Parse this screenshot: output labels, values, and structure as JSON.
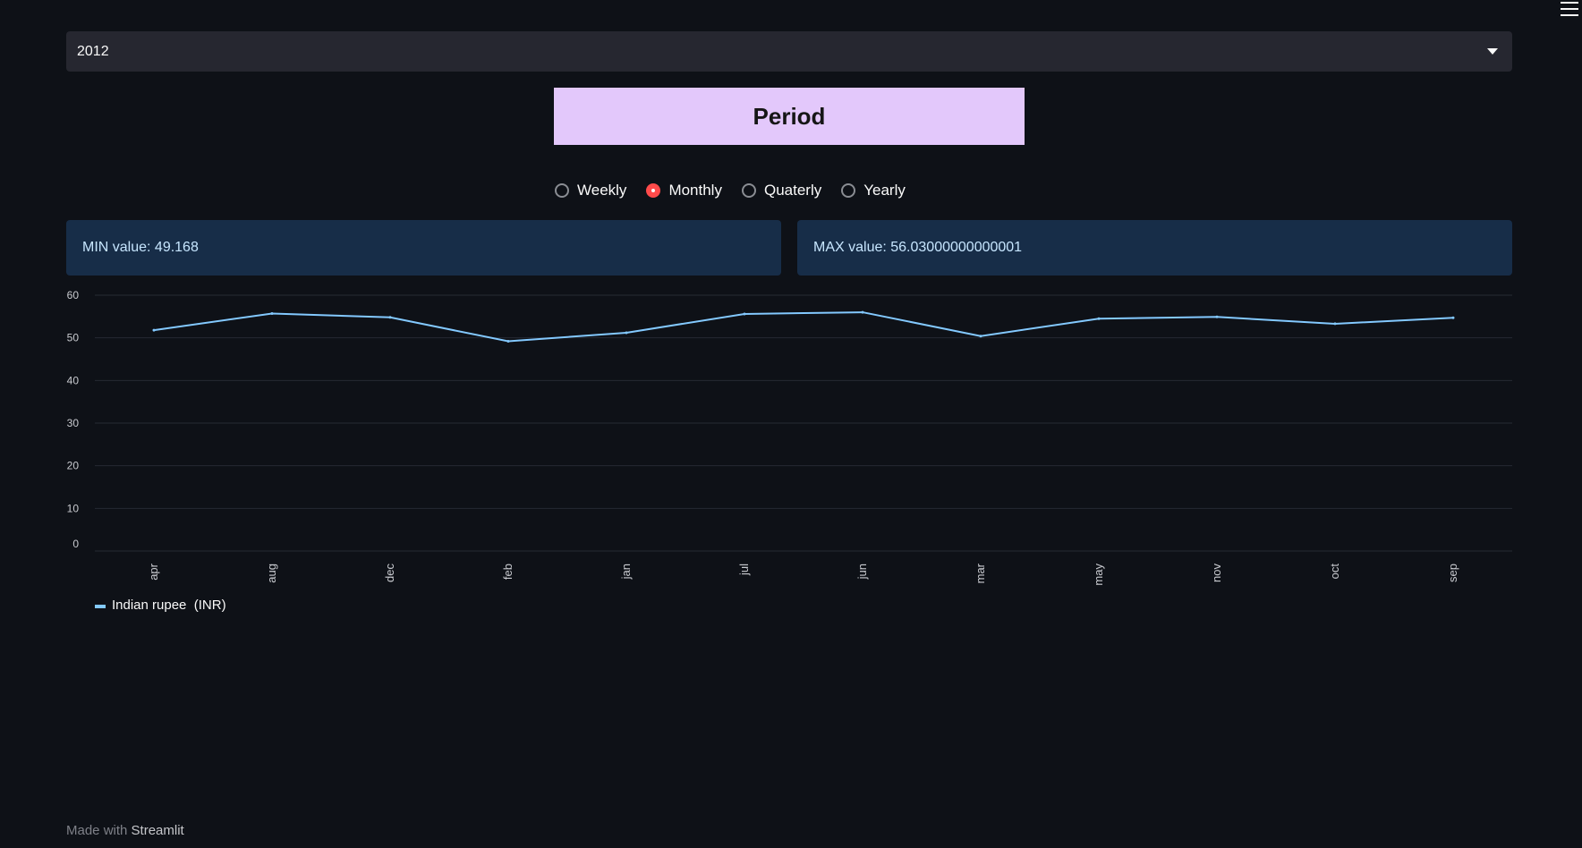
{
  "select": {
    "value": "2012"
  },
  "period": {
    "title": "Period"
  },
  "radios": [
    {
      "label": "Weekly",
      "checked": false
    },
    {
      "label": "Monthly",
      "checked": true
    },
    {
      "label": "Quaterly",
      "checked": false
    },
    {
      "label": "Yearly",
      "checked": false
    }
  ],
  "metrics": {
    "min": "MIN value: 49.168",
    "max": "MAX value: 56.03000000000001"
  },
  "footer": {
    "prefix": "Made with ",
    "brand": "Streamlit"
  },
  "colors": {
    "background": "#0e1117",
    "series": "#83c9ff",
    "period_box": "#e3c8fb",
    "radio_active": "#ff4b4b",
    "metric_bg": "#172d48"
  },
  "chart_data": {
    "type": "line",
    "categories": [
      "apr",
      "aug",
      "dec",
      "feb",
      "jan",
      "jul",
      "jun",
      "mar",
      "may",
      "nov",
      "oct",
      "sep"
    ],
    "series": [
      {
        "name": "Indian rupee  (INR)",
        "values": [
          51.8,
          55.7,
          54.8,
          49.2,
          51.2,
          55.6,
          56.0,
          50.4,
          54.5,
          54.9,
          53.3,
          54.7
        ]
      }
    ],
    "yticks": [
      "60",
      "50",
      "40",
      "30",
      "20",
      "10",
      "0"
    ],
    "ylim": [
      0,
      60
    ],
    "grid": true,
    "legend": "bottom-left"
  }
}
